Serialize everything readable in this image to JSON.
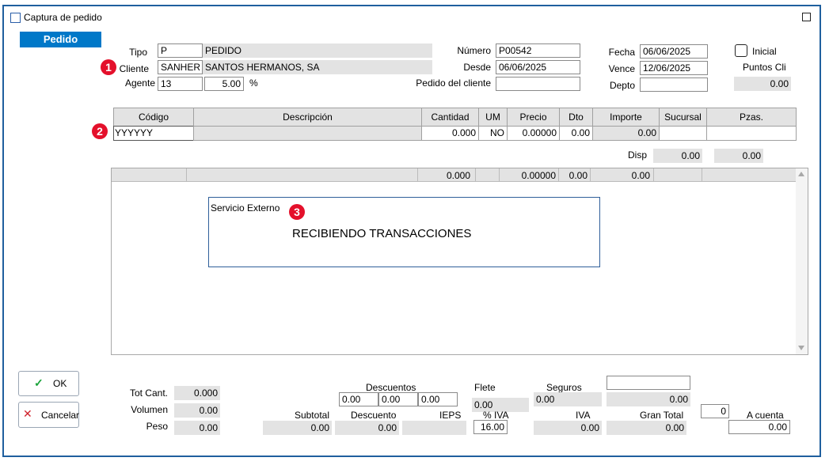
{
  "window": {
    "title": "Captura de pedido"
  },
  "tab": {
    "label": "Pedido"
  },
  "header": {
    "tipo_label": "Tipo",
    "tipo_code": "P",
    "tipo_desc": "PEDIDO",
    "cliente_label": "Cliente",
    "cliente_code": "SANHER",
    "cliente_name": "SANTOS HERMANOS, SA",
    "agente_label": "Agente",
    "agente_code": "13",
    "agente_pct": "5.00",
    "pct_sign": "%",
    "numero_label": "Número",
    "numero_value": "P00542",
    "desde_label": "Desde",
    "desde_value": "06/06/2025",
    "pedido_cliente_label": "Pedido del cliente",
    "pedido_cliente_value": "",
    "fecha_label": "Fecha",
    "fecha_value": "06/06/2025",
    "vence_label": "Vence",
    "vence_value": "12/06/2025",
    "depto_label": "Depto",
    "depto_value": "",
    "inicial_label": "Inicial",
    "puntos_label": "Puntos Cli",
    "puntos_value": "0.00"
  },
  "badges": [
    "1",
    "2",
    "3"
  ],
  "grid": {
    "columns": [
      "Código",
      "Descripción",
      "Cantidad",
      "UM",
      "Precio",
      "Dto",
      "Importe",
      "Sucursal",
      "Pzas."
    ],
    "row": {
      "codigo": "YYYYYY",
      "descripcion": "",
      "cantidad": "0.000",
      "um": "NO",
      "precio": "0.00000",
      "dto": "0.00",
      "importe": "0.00",
      "sucursal": "",
      "pzas": ""
    },
    "disp_label": "Disp",
    "disp_value1": "0.00",
    "disp_value2": "0.00"
  },
  "list": {
    "summary": {
      "cantidad": "0.000",
      "precio": "0.00000",
      "dto": "0.00",
      "importe": "0.00"
    }
  },
  "dialog": {
    "title": "Servicio Externo",
    "message": "RECIBIENDO TRANSACCIONES"
  },
  "buttons": {
    "ok": "OK",
    "cancel": "Cancelar"
  },
  "totals": {
    "tot_cant_label": "Tot Cant.",
    "tot_cant_value": "0.000",
    "volumen_label": "Volumen",
    "volumen_value": "0.00",
    "peso_label": "Peso",
    "peso_value": "0.00",
    "descuentos_label": "Descuentos",
    "desc1": "0.00",
    "desc2": "0.00",
    "desc3": "0.00",
    "subtotal_label": "Subtotal",
    "subtotal_value": "0.00",
    "descuento_label": "Descuento",
    "descuento_value": "0.00",
    "ieps_label": "IEPS",
    "ieps_value": "",
    "flete_label": "Flete",
    "flete_value": "0.00",
    "iva_pct_label": "% IVA",
    "iva_pct_value": "16.00",
    "seguros_label": "Seguros",
    "seguros_value": "0.00",
    "iva_label": "IVA",
    "iva_value": "0.00",
    "extra_field": "",
    "extra_value": "0.00",
    "gran_total_label": "Gran Total",
    "gran_total_value": "0.00",
    "small_field": "0",
    "a_cuenta_label": "A cuenta",
    "a_cuenta_value": "0.00"
  }
}
